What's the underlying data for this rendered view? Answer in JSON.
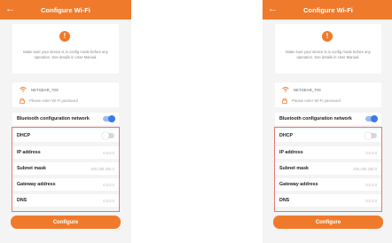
{
  "screen": {
    "title": "Configure Wi-Fi",
    "warning_text": "Make sure your device is in config mode before any operation. See details in User Manual.",
    "ssid": "NETGEAR_70S",
    "password_placeholder": "Please enter Wi-Fi password",
    "bluetooth": {
      "label": "Bluetooth configuration network",
      "enabled": true
    },
    "dhcp": {
      "label": "DHCP",
      "enabled": false
    },
    "fields": [
      {
        "label": "IP address",
        "value": "0.0.0.0"
      },
      {
        "label": "Subnet mask",
        "value": "255.255.255.0"
      },
      {
        "label": "Gateway address",
        "value": "0.0.0.0"
      },
      {
        "label": "DNS",
        "value": "0.0.0.0"
      }
    ],
    "configure_label": "Configure"
  },
  "icons": {
    "back": "arrow-left-icon",
    "warning": "exclamation-circle-icon",
    "wifi": "wifi-icon",
    "lock": "lock-icon"
  },
  "colors": {
    "accent": "#f07a2c",
    "toggle_on": "#3b7be8",
    "highlight": "#e27a75"
  }
}
